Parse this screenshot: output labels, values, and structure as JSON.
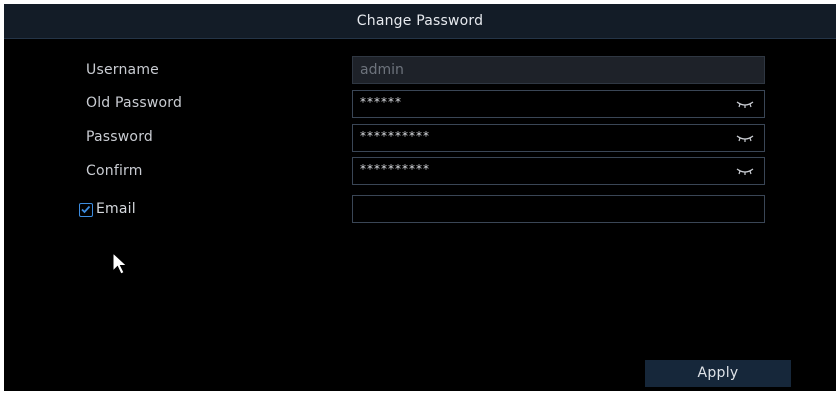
{
  "dialog": {
    "title": "Change Password"
  },
  "form": {
    "username": {
      "label": "Username",
      "value": "admin"
    },
    "old_password": {
      "label": "Old Password",
      "value": "******"
    },
    "password": {
      "label": "Password",
      "value": "**********"
    },
    "confirm": {
      "label": "Confirm",
      "value": "**********"
    },
    "email": {
      "label": "Email",
      "checked": true,
      "value": ""
    }
  },
  "buttons": {
    "apply_label": "Apply"
  },
  "icons": {
    "eye": "eye-closed-icon",
    "checkbox_color": "#3d8de0"
  }
}
